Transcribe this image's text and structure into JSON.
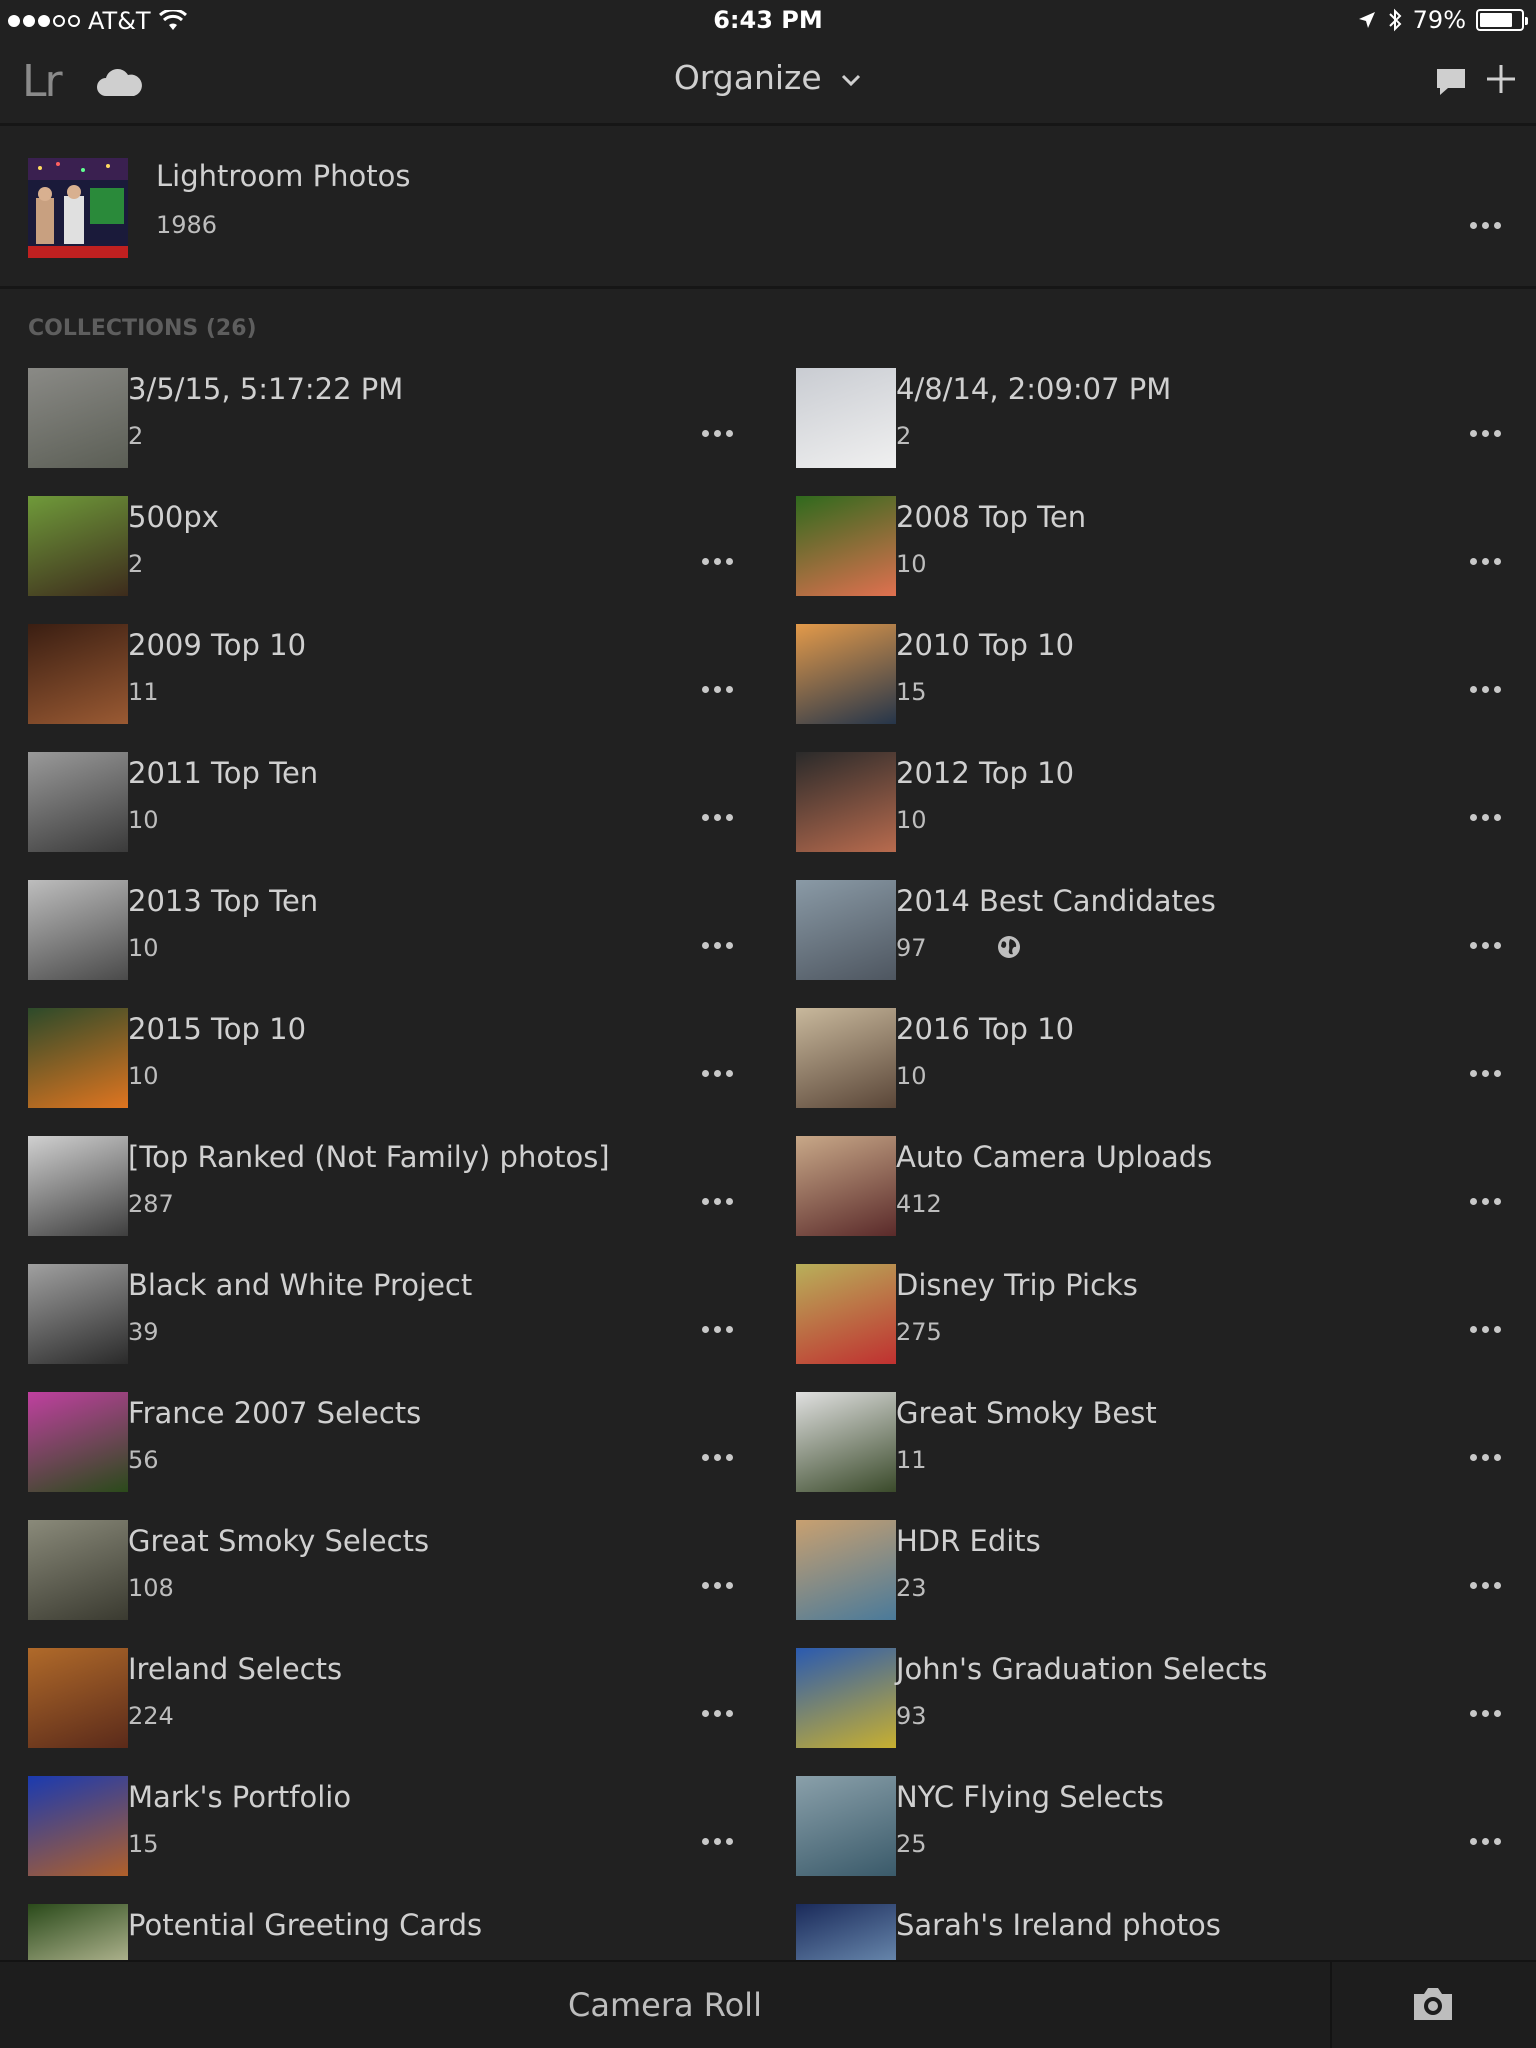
{
  "status_bar": {
    "carrier": "AT&T",
    "time": "6:43 PM",
    "battery": "79%",
    "battery_level": 0.79
  },
  "nav": {
    "logo": "Lr",
    "title": "Organize"
  },
  "all_photos": {
    "name": "Lightroom Photos",
    "count": "1986"
  },
  "collections_label": "COLLECTIONS (26)",
  "collections": [
    {
      "name": "3/5/15, 5:17:22 PM",
      "count": "2",
      "thumb": [
        "#8a8a86",
        "#5b5e55"
      ]
    },
    {
      "name": "4/8/14, 2:09:07 PM",
      "count": "2",
      "thumb": [
        "#c9ccd2",
        "#f0f0f0"
      ]
    },
    {
      "name": "500px",
      "count": "2",
      "thumb": [
        "#6f9a3a",
        "#3d2b1c"
      ]
    },
    {
      "name": "2008 Top Ten",
      "count": "10",
      "thumb": [
        "#2f6a1d",
        "#e07050"
      ]
    },
    {
      "name": "2009 Top 10",
      "count": "11",
      "thumb": [
        "#3a1e12",
        "#9a5a33"
      ]
    },
    {
      "name": "2010 Top 10",
      "count": "15",
      "thumb": [
        "#e39a4a",
        "#25354a"
      ]
    },
    {
      "name": "2011 Top Ten",
      "count": "10",
      "thumb": [
        "#9a9a9a",
        "#3a3a3a"
      ]
    },
    {
      "name": "2012 Top 10",
      "count": "10",
      "thumb": [
        "#2a2a2a",
        "#b86b4e"
      ]
    },
    {
      "name": "2013 Top Ten",
      "count": "10",
      "thumb": [
        "#bdbdbd",
        "#4a4a4a"
      ]
    },
    {
      "name": "2014 Best Candidates",
      "count": "97",
      "thumb": [
        "#8a9aa6",
        "#4e5660"
      ],
      "shared": true
    },
    {
      "name": "2015 Top 10",
      "count": "10",
      "thumb": [
        "#2c4a2a",
        "#e07520"
      ]
    },
    {
      "name": "2016 Top 10",
      "count": "10",
      "thumb": [
        "#c8b89c",
        "#5a4638"
      ]
    },
    {
      "name": "[Top Ranked (Not Family) photos]",
      "count": "287",
      "thumb": [
        "#d0d0d0",
        "#3e3e3e"
      ]
    },
    {
      "name": "Auto Camera Uploads",
      "count": "412",
      "thumb": [
        "#c8a888",
        "#5a2a2a"
      ]
    },
    {
      "name": "Black and White Project",
      "count": "39",
      "thumb": [
        "#a0a0a0",
        "#2a2a2a"
      ]
    },
    {
      "name": "Disney Trip Picks",
      "count": "275",
      "thumb": [
        "#b8b05a",
        "#c03030"
      ]
    },
    {
      "name": "France 2007 Selects",
      "count": "56",
      "thumb": [
        "#c040a0",
        "#2a4a1a"
      ]
    },
    {
      "name": "Great Smoky Best",
      "count": "11",
      "thumb": [
        "#e0e0e0",
        "#3a4a2a"
      ]
    },
    {
      "name": "Great Smoky Selects",
      "count": "108",
      "thumb": [
        "#8a8a7a",
        "#3a3a30"
      ]
    },
    {
      "name": "HDR Edits",
      "count": "23",
      "thumb": [
        "#c8a070",
        "#4a7a9a"
      ]
    },
    {
      "name": "Ireland Selects",
      "count": "224",
      "thumb": [
        "#b06a2a",
        "#5a2a1a"
      ]
    },
    {
      "name": "John's Graduation Selects",
      "count": "93",
      "thumb": [
        "#2a5ab0",
        "#c8b030"
      ]
    },
    {
      "name": "Mark's Portfolio",
      "count": "15",
      "thumb": [
        "#1a3ab0",
        "#b0602a"
      ]
    },
    {
      "name": "NYC Flying Selects",
      "count": "25",
      "thumb": [
        "#8aa0aa",
        "#3a5a6a"
      ]
    },
    {
      "name": "Potential Greeting Cards",
      "count": "",
      "thumb": [
        "#2a4a1a",
        "#e8e0c0"
      ]
    },
    {
      "name": "Sarah's Ireland photos",
      "count": "",
      "thumb": [
        "#1a2a5a",
        "#8ab0d0"
      ]
    }
  ],
  "bottom_bar": {
    "camera_roll": "Camera Roll"
  },
  "icons": {
    "cloud": "cloud-icon",
    "chat": "chat-icon",
    "add": "plus-icon",
    "more": "more-icon",
    "shared": "globe-icon",
    "camera": "camera-icon"
  }
}
